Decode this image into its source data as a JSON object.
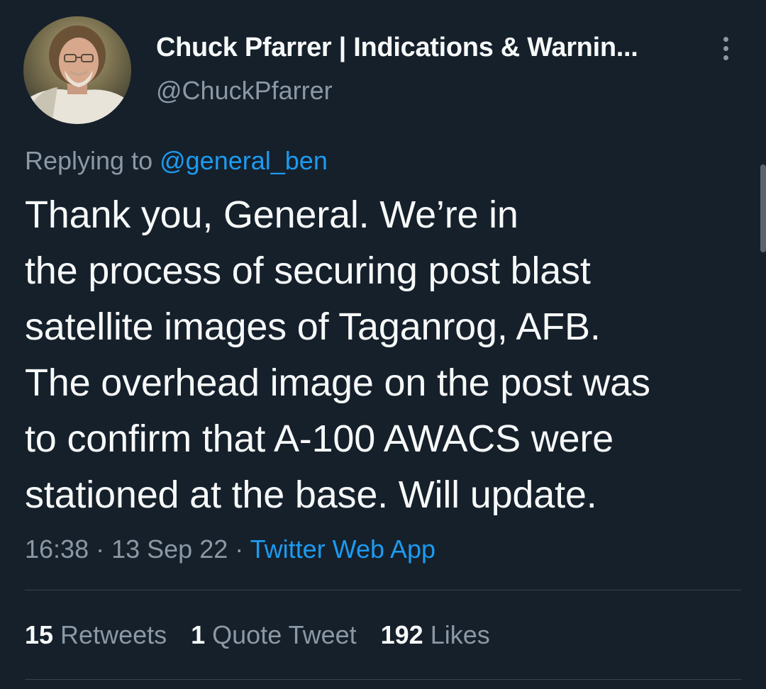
{
  "author": {
    "display_name": "Chuck Pfarrer | Indications & Warnin...",
    "handle": "@ChuckPfarrer",
    "avatar_icon": "profile-photo"
  },
  "more_icon": "more-vertical-icon",
  "reply": {
    "prefix": "Replying to ",
    "mention": "@general_ben"
  },
  "tweet": {
    "text": "Thank you, General.   We’re in\nthe process of securing post blast\nsatellite images of Taganrog, AFB.\nThe overhead image on the post was\nto confirm that A-100 AWACS were\nstationed at the base.  Will update.",
    "time": "16:38",
    "date": "13 Sep 22",
    "separator": " · ",
    "source": "Twitter Web App"
  },
  "stats": {
    "retweets_count": "15",
    "retweets_label": " Retweets",
    "quotes_count": "1",
    "quotes_label": " Quote Tweet",
    "likes_count": "192",
    "likes_label": " Likes"
  },
  "colors": {
    "background": "#15202b",
    "text": "#f7f9f9",
    "secondary": "#8b98a5",
    "accent": "#1d9bf0",
    "divider": "#38444d"
  }
}
